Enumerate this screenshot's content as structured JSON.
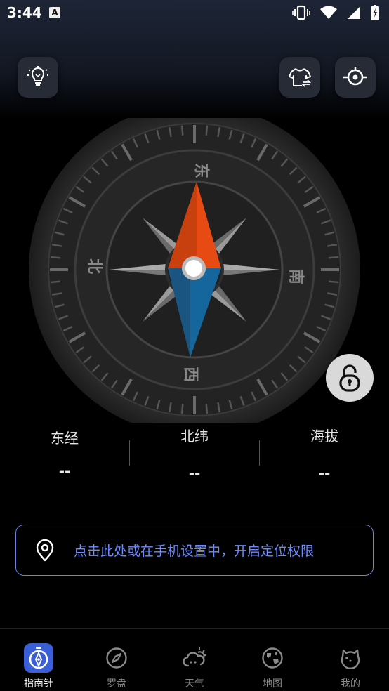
{
  "status_bar": {
    "time": "3:44",
    "notification_glyph": "A"
  },
  "compass": {
    "directions": {
      "top": "东",
      "right": "南",
      "bottom": "西",
      "left": "北"
    },
    "colors": {
      "north_needle": "#e84a14",
      "south_needle": "#16669e"
    }
  },
  "coordinates": [
    {
      "label": "东经",
      "value": "--"
    },
    {
      "label": "北纬",
      "value": "--"
    },
    {
      "label": "海拔",
      "value": "--"
    }
  ],
  "location_prompt": "点击此处或在手机设置中，开启定位权限",
  "tabs": [
    {
      "label": "指南针",
      "icon": "compass-icon",
      "active": true
    },
    {
      "label": "罗盘",
      "icon": "compass-outline-icon",
      "active": false
    },
    {
      "label": "天气",
      "icon": "weather-icon",
      "active": false
    },
    {
      "label": "地图",
      "icon": "map-icon",
      "active": false
    },
    {
      "label": "我的",
      "icon": "profile-icon",
      "active": false
    }
  ],
  "icons": {
    "light": "lightbulb-icon",
    "skin": "shirt-icon",
    "calibrate": "target-icon",
    "lock": "unlock-icon",
    "location": "location-pin-icon"
  }
}
